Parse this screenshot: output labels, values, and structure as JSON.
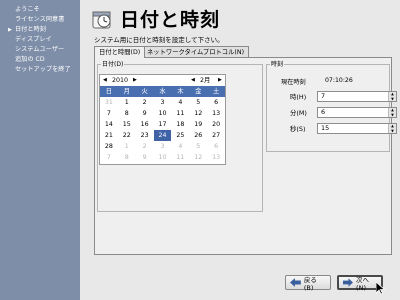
{
  "sidebar": {
    "items": [
      {
        "label": "ようこそ",
        "current": false
      },
      {
        "label": "ライセンス同意書",
        "current": false
      },
      {
        "label": "日付と時刻",
        "current": true
      },
      {
        "label": "ディスプレイ",
        "current": false
      },
      {
        "label": "システムユーザー",
        "current": false
      },
      {
        "label": "追加の CD",
        "current": false
      },
      {
        "label": "セットアップを終了",
        "current": false
      }
    ]
  },
  "header": {
    "title": "日付と時刻",
    "icon": "calendar-icon"
  },
  "description": "システム用に日付と時刻を設定して下さい。",
  "tabs": [
    {
      "label": "日付と時間(D)",
      "active": true
    },
    {
      "label": "ネットワークタイムプロトコル(N)",
      "active": false
    }
  ],
  "date": {
    "frame_label": "日付(D)",
    "year": "2010",
    "month": "2月",
    "weekdays": [
      "日",
      "月",
      "火",
      "水",
      "木",
      "金",
      "土"
    ],
    "weeks": [
      [
        "31",
        "1",
        "2",
        "3",
        "4",
        "5",
        "6"
      ],
      [
        "7",
        "8",
        "9",
        "10",
        "11",
        "12",
        "13"
      ],
      [
        "14",
        "15",
        "16",
        "17",
        "18",
        "19",
        "20"
      ],
      [
        "21",
        "22",
        "23",
        "24",
        "25",
        "26",
        "27"
      ],
      [
        "28",
        "1",
        "2",
        "3",
        "4",
        "5",
        "6"
      ],
      [
        "7",
        "8",
        "9",
        "10",
        "11",
        "12",
        "13"
      ]
    ],
    "selected_day": "24"
  },
  "time": {
    "frame_label": "時刻",
    "current_label": "現在時刻",
    "current_value": "07:10:26",
    "hour_label": "時(H)",
    "hour_value": "7",
    "minute_label": "分(M)",
    "minute_value": "6",
    "second_label": "秒(S)",
    "second_value": "15"
  },
  "buttons": {
    "back": "戻る(B)",
    "next": "次へ(N)"
  },
  "colors": {
    "sidebar_bg": "#7e8ea8",
    "calendar_header": "#4a6fb0",
    "selected_day": "#3f63a6"
  }
}
